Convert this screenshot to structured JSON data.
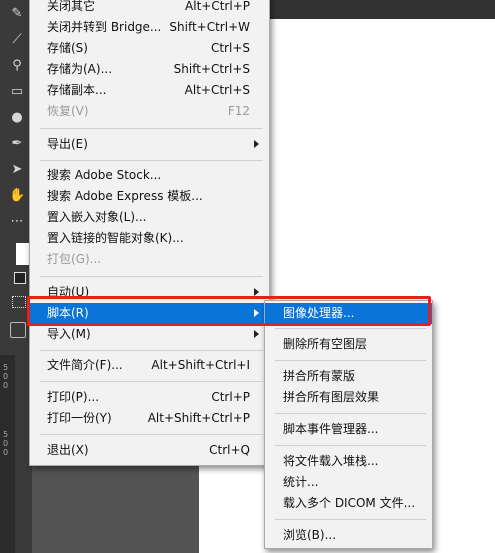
{
  "file_menu": {
    "items": [
      {
        "label": "关闭其它",
        "shortcut": "Alt+Ctrl+P"
      },
      {
        "label": "关闭并转到 Bridge...",
        "shortcut": "Shift+Ctrl+W"
      },
      {
        "label": "存储(S)",
        "shortcut": "Ctrl+S"
      },
      {
        "label": "存储为(A)...",
        "shortcut": "Shift+Ctrl+S"
      },
      {
        "label": "存储副本...",
        "shortcut": "Alt+Ctrl+S"
      },
      {
        "label": "恢复(V)",
        "shortcut": "F12"
      },
      {
        "label": "导出(E)",
        "shortcut": ""
      },
      {
        "label": "搜索 Adobe Stock...",
        "shortcut": ""
      },
      {
        "label": "搜索 Adobe Express 模板...",
        "shortcut": ""
      },
      {
        "label": "置入嵌入对象(L)...",
        "shortcut": ""
      },
      {
        "label": "置入链接的智能对象(K)...",
        "shortcut": ""
      },
      {
        "label": "打包(G)...",
        "shortcut": ""
      },
      {
        "label": "自动(U)",
        "shortcut": ""
      },
      {
        "label": "脚本(R)",
        "shortcut": ""
      },
      {
        "label": "导入(M)",
        "shortcut": ""
      },
      {
        "label": "文件简介(F)...",
        "shortcut": "Alt+Shift+Ctrl+I"
      },
      {
        "label": "打印(P)...",
        "shortcut": "Ctrl+P"
      },
      {
        "label": "打印一份(Y)",
        "shortcut": "Alt+Shift+Ctrl+P"
      },
      {
        "label": "退出(X)",
        "shortcut": "Ctrl+Q"
      }
    ]
  },
  "scripts_submenu": {
    "items": [
      {
        "label": "图像处理器..."
      },
      {
        "label": "删除所有空图层"
      },
      {
        "label": "拼合所有蒙版"
      },
      {
        "label": "拼合所有图层效果"
      },
      {
        "label": "脚本事件管理器..."
      },
      {
        "label": "将文件载入堆栈..."
      },
      {
        "label": "统计..."
      },
      {
        "label": "载入多个 DICOM 文件..."
      },
      {
        "label": "浏览(B)..."
      }
    ]
  },
  "toolbar": {
    "icons": [
      "eyedropper-icon",
      "brush-icon",
      "clone-stamp-icon",
      "eraser-icon",
      "dodge-icon",
      "pen-icon",
      "move-icon",
      "hand-icon",
      "more-tools-icon"
    ]
  },
  "ruler_numbers": [
    "5",
    "0",
    "0",
    "5",
    "0",
    "0"
  ],
  "colors": {
    "highlight": "#0a74d9",
    "annotation": "#e5211b",
    "menu_bg": "#f2f2f2"
  }
}
